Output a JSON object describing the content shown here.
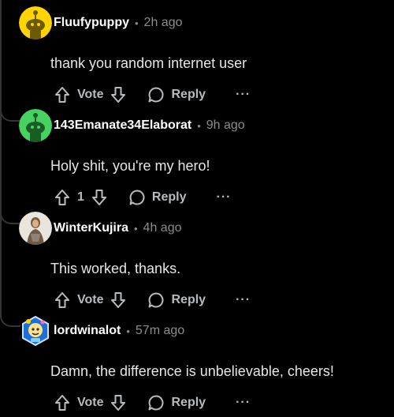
{
  "comments": [
    {
      "username": "Fluufypuppy",
      "separator": "•",
      "time": "2h ago",
      "text": "thank you random internet user",
      "vote_label": "Vote",
      "reply_label": "Reply",
      "more_label": "···",
      "avatar": "snoo-yellow"
    },
    {
      "username": "143Emanate34Elaborat",
      "separator": "•",
      "time": "9h ago",
      "text": "Holy shit, you're my hero!",
      "vote_label": "1",
      "reply_label": "Reply",
      "more_label": "···",
      "avatar": "snoo-green"
    },
    {
      "username": "WinterKujira",
      "separator": "•",
      "time": "4h ago",
      "text": "This worked, thanks.",
      "vote_label": "Vote",
      "reply_label": "Reply",
      "more_label": "···",
      "avatar": "character-portrait"
    },
    {
      "username": "lordwinalot",
      "separator": "•",
      "time": "57m ago",
      "text": "Damn, the difference is unbelievable, cheers!",
      "vote_label": "Vote",
      "reply_label": "Reply",
      "more_label": "···",
      "avatar": "hexagon-character"
    }
  ],
  "colors": {
    "background": "#000000",
    "thread_line": "#343536",
    "username": "#ffffff",
    "meta": "#8a8d8f",
    "action": "#b8bbbe"
  }
}
